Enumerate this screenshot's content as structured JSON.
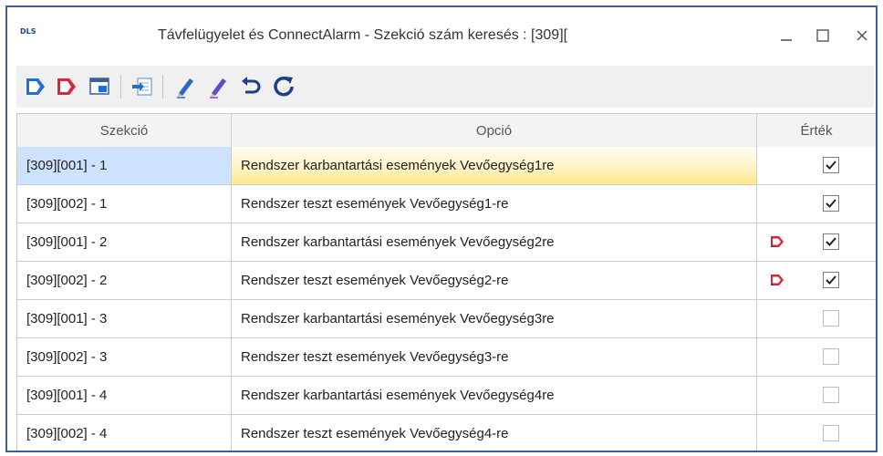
{
  "window": {
    "logo_text": "DLS",
    "title": "Távfelügyelet és ConnectAlarm - Szekció szám keresés : [309]["
  },
  "colors": {
    "accent_blue": "#1e6fd6",
    "flag_red": "#e0233a",
    "selection_blue": "#cce2ff",
    "selection_yellow": "#ffe88a"
  },
  "toolbar": {
    "icons": [
      "tag-blue-icon",
      "tag-red-icon",
      "window-grid-icon",
      "import-icon",
      "pencil-blue-icon",
      "pencil-purple-icon",
      "undo-icon",
      "refresh-icon"
    ]
  },
  "table": {
    "columns": [
      "Szekció",
      "Opció",
      "Érték"
    ],
    "rows": [
      {
        "section": "[309][001] - 1",
        "option": "Rendszer karbantartási események Vevőegység1re",
        "checked": true,
        "flag": false,
        "selected": true
      },
      {
        "section": "[309][002] - 1",
        "option": "Rendszer teszt események Vevőegység1-re",
        "checked": true,
        "flag": false,
        "selected": false
      },
      {
        "section": "[309][001] - 2",
        "option": "Rendszer karbantartási események Vevőegység2re",
        "checked": true,
        "flag": true,
        "selected": false
      },
      {
        "section": "[309][002] - 2",
        "option": "Rendszer teszt események Vevőegység2-re",
        "checked": true,
        "flag": true,
        "selected": false
      },
      {
        "section": "[309][001] - 3",
        "option": "Rendszer karbantartási események Vevőegység3re",
        "checked": false,
        "flag": false,
        "selected": false
      },
      {
        "section": "[309][002] - 3",
        "option": "Rendszer teszt események Vevőegység3-re",
        "checked": false,
        "flag": false,
        "selected": false
      },
      {
        "section": "[309][001] - 4",
        "option": "Rendszer karbantartási események Vevőegység4re",
        "checked": false,
        "flag": false,
        "selected": false
      },
      {
        "section": "[309][002] - 4",
        "option": "Rendszer teszt események Vevőegység4-re",
        "checked": false,
        "flag": false,
        "selected": false
      }
    ]
  }
}
